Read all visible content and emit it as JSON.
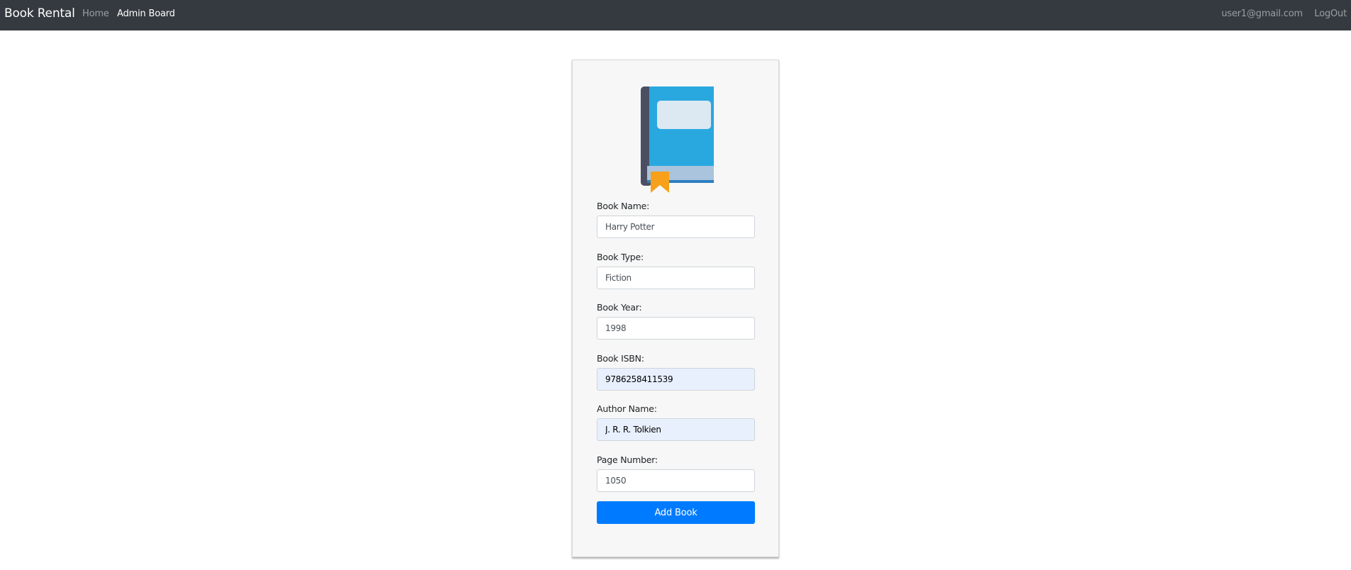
{
  "navbar": {
    "brand": "Book Rental",
    "links": {
      "home": "Home",
      "admin_board": "Admin Board",
      "user_email": "user1@gmail.com",
      "logout": "LogOut"
    }
  },
  "form": {
    "icon": "book-icon",
    "fields": {
      "book_name": {
        "label": "Book Name:",
        "value": "Harry Potter"
      },
      "book_type": {
        "label": "Book Type:",
        "value": "Fiction"
      },
      "book_year": {
        "label": "Book Year:",
        "value": "1998"
      },
      "book_isbn": {
        "label": "Book ISBN:",
        "value": "9786258411539"
      },
      "author_name": {
        "label": "Author Name:",
        "value": "J. R. R. Tolkien"
      },
      "page_number": {
        "label": "Page Number:",
        "value": "1050"
      }
    },
    "submit_label": "Add Book"
  },
  "colors": {
    "navbar_bg": "#343a40",
    "card_bg": "#f7f7f7",
    "primary": "#007bff",
    "autofill_bg": "#e8f0fe"
  }
}
